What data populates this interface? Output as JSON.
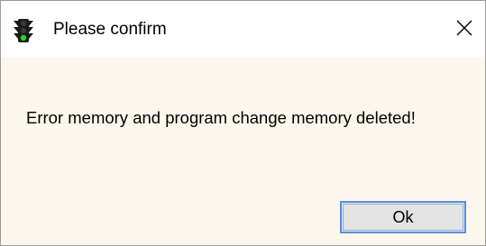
{
  "window": {
    "title": "Please confirm",
    "app_icon": "traffic-light-icon",
    "close_icon": "close-icon"
  },
  "dialog": {
    "message": "Error memory and program change memory deleted!",
    "ok_label": "Ok"
  },
  "colors": {
    "client_background": "#fbf7ec",
    "titlebar_background": "#ffffff",
    "button_border": "#5c8ed6",
    "button_face": "#e3e3e3"
  }
}
